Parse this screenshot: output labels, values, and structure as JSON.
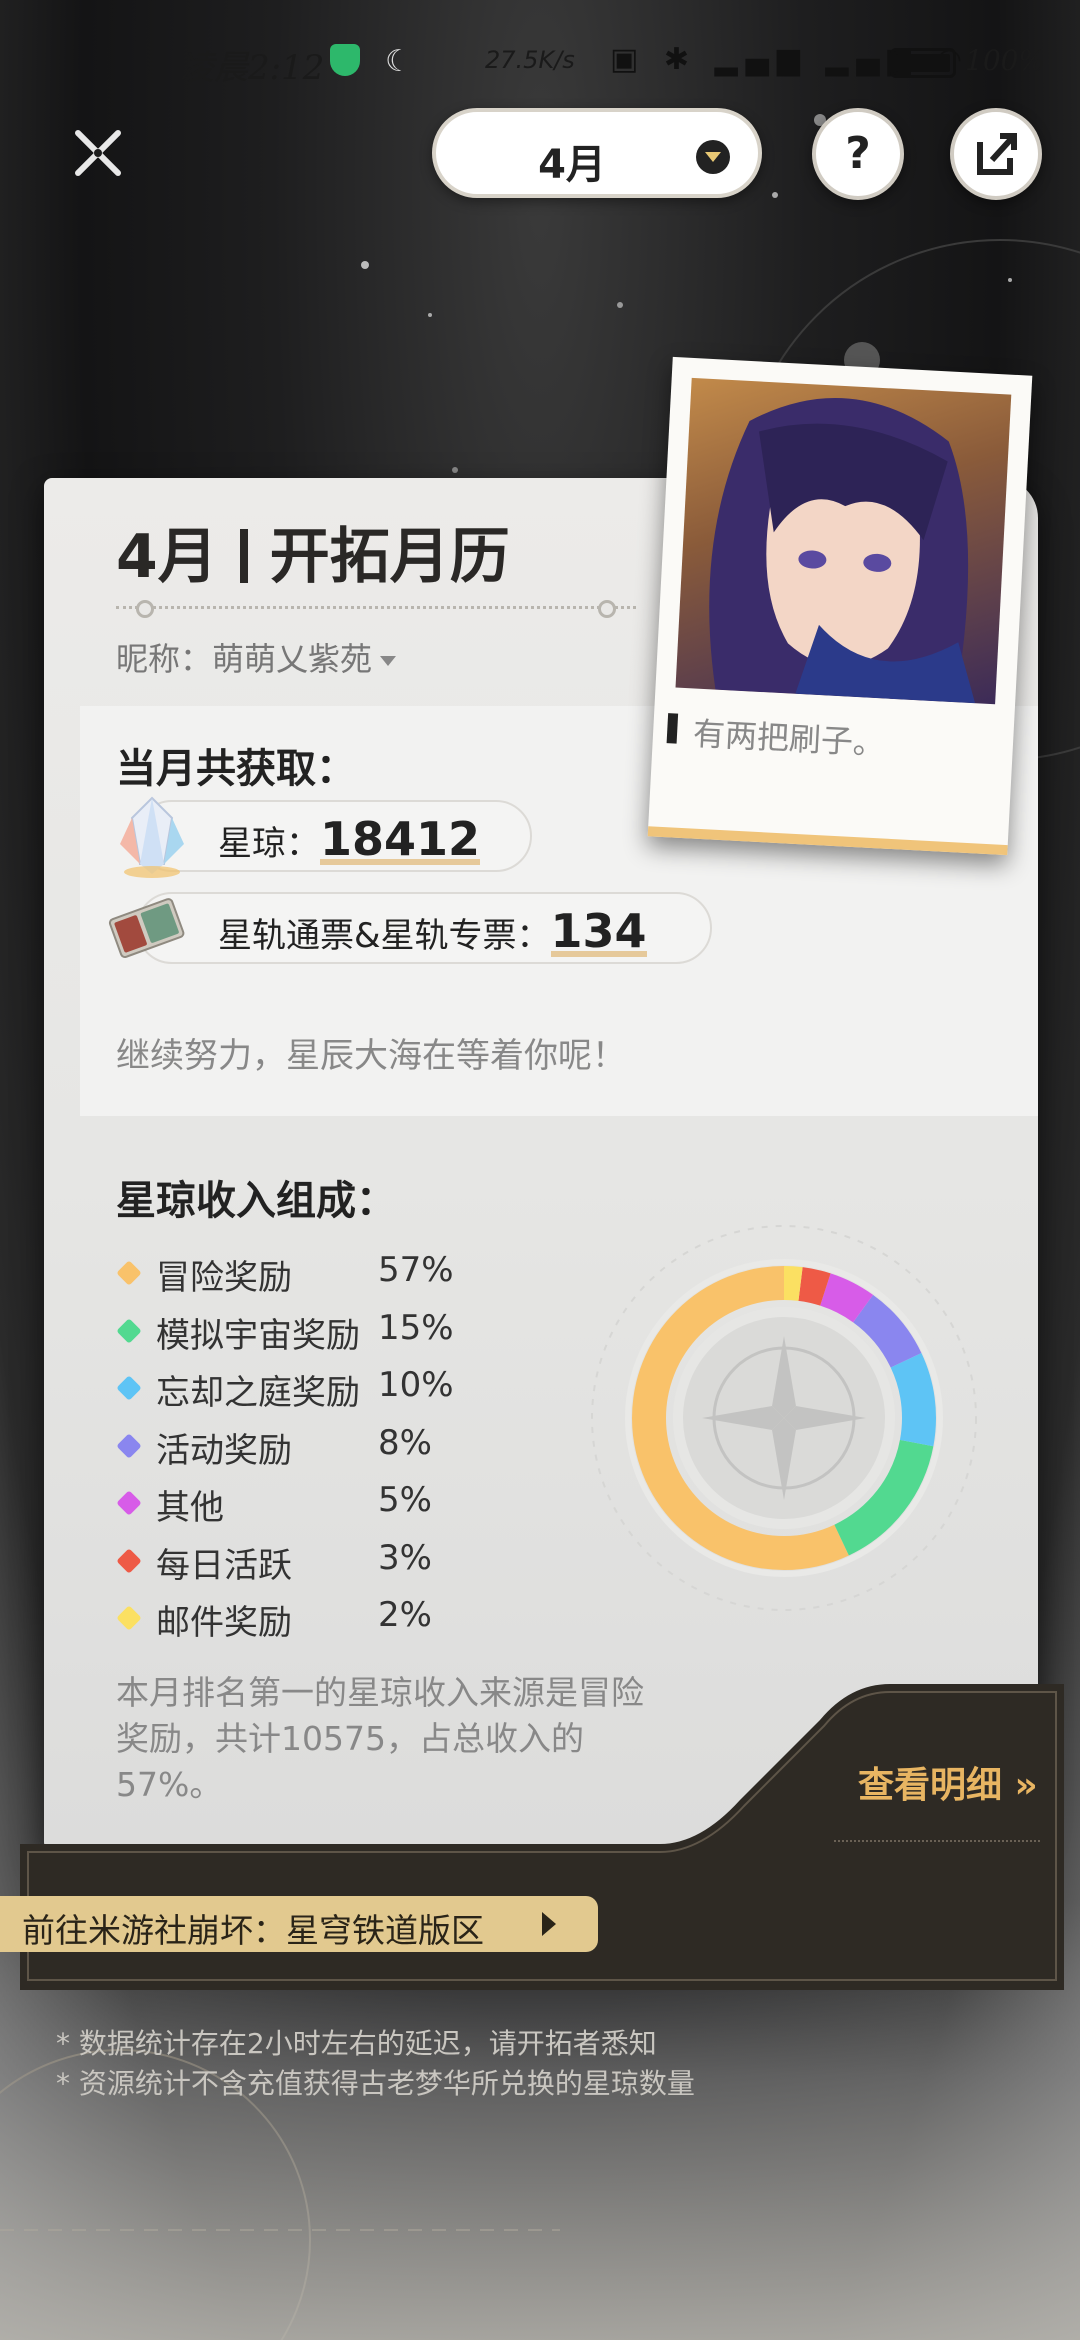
{
  "status_bar": {
    "time": "凌晨2:12",
    "net_speed": "27.5K/s",
    "battery": "100%"
  },
  "header": {
    "month_selector": "4月",
    "help_label": "?"
  },
  "card": {
    "title_month": "4月",
    "title_text": "开拓月历",
    "nickname_label": "昵称：",
    "nickname": "萌萌乂紫苑",
    "portrait_quote": "有两把刷子。",
    "earned": {
      "heading": "当月共获取：",
      "stellar_jade_label": "星琼：",
      "stellar_jade_value": "18412",
      "pass_label": "星轨通票&星轨专票：",
      "pass_value": "134",
      "encouragement": "继续努力，星辰大海在等着你呢！"
    },
    "composition": {
      "heading": "星琼收入组成：",
      "items": [
        {
          "name": "冒险奖励",
          "pct": "57%",
          "value": 57,
          "color": "#f9c26a"
        },
        {
          "name": "模拟宇宙奖励",
          "pct": "15%",
          "value": 15,
          "color": "#52d990"
        },
        {
          "name": "忘却之庭奖励",
          "pct": "10%",
          "value": 10,
          "color": "#5ec4f5"
        },
        {
          "name": "活动奖励",
          "pct": "8%",
          "value": 8,
          "color": "#8a86ef"
        },
        {
          "name": "其他",
          "pct": "5%",
          "value": 5,
          "color": "#d75ce8"
        },
        {
          "name": "每日活跃",
          "pct": "3%",
          "value": 3,
          "color": "#ee5a46"
        },
        {
          "name": "邮件奖励",
          "pct": "2%",
          "value": 2,
          "color": "#fbe062"
        }
      ],
      "summary": "本月排名第一的星琼收入来源是冒险奖励，共计10575，占总收入的57%。"
    }
  },
  "detail_link": "查看明细 »",
  "forum_button": "前往米游社崩坏：星穹铁道版区",
  "notes": [
    "* 数据统计存在2小时左右的延迟，请开拓者悉知",
    "* 资源统计不含充值获得古老梦华所兑换的星琼数量"
  ]
}
